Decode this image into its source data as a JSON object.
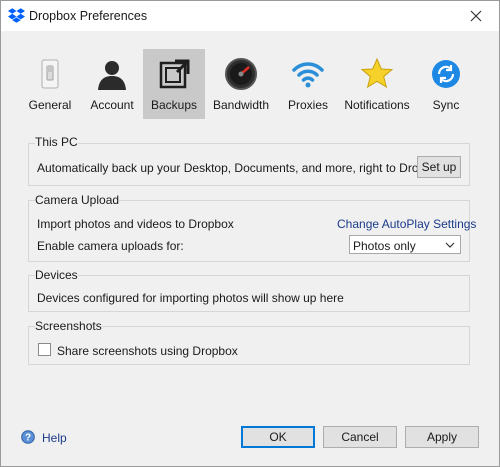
{
  "window": {
    "title": "Dropbox Preferences"
  },
  "tabs": [
    {
      "label": "General",
      "icon": "light-switch-icon"
    },
    {
      "label": "Account",
      "icon": "user-silhouette-icon"
    },
    {
      "label": "Backups",
      "icon": "backup-arrow-icon",
      "active": true
    },
    {
      "label": "Bandwidth",
      "icon": "speedometer-icon"
    },
    {
      "label": "Proxies",
      "icon": "wifi-icon"
    },
    {
      "label": "Notifications",
      "icon": "star-icon"
    },
    {
      "label": "Sync",
      "icon": "sync-icon"
    }
  ],
  "this_pc": {
    "title": "This PC",
    "description": "Automatically back up your Desktop, Documents, and more, right to Dropbox",
    "button": "Set up"
  },
  "camera_upload": {
    "title": "Camera Upload",
    "import_text": "Import photos and videos to Dropbox",
    "autoplay_link": "Change AutoPlay Settings",
    "enable_label": "Enable camera uploads for:",
    "select_value": "Photos only"
  },
  "devices": {
    "title": "Devices",
    "text": "Devices configured for importing photos will show up here"
  },
  "screenshots": {
    "title": "Screenshots",
    "checkbox_label": "Share screenshots using Dropbox",
    "checked": false
  },
  "footer": {
    "help": "Help",
    "ok": "OK",
    "cancel": "Cancel",
    "apply": "Apply"
  },
  "colors": {
    "accent": "#0078d7",
    "dropbox_blue": "#0061fe",
    "link": "#1b3a8a",
    "active_tab": "#c9c9c9"
  }
}
